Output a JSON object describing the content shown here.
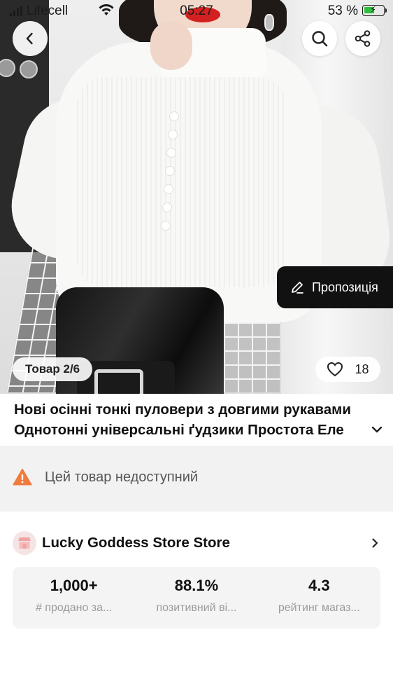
{
  "status_bar": {
    "carrier": "Lifecell",
    "time": "05:27",
    "battery_pct": "53 %",
    "battery_level": 0.53,
    "battery_color": "#2fbf3b"
  },
  "nav": {
    "back_icon": "chevron-left-icon",
    "search_icon": "search-icon",
    "share_icon": "share-icon"
  },
  "gallery": {
    "counter": "Товар 2/6",
    "likes": "18",
    "proposal_label": "Пропозиція"
  },
  "product": {
    "title_line1": "Нові осінні тонкі пуловери з довгими рукавами",
    "title_line2": "Однотонні універсальні ґудзики Простота Еле"
  },
  "availability": {
    "message": "Цей товар недоступний",
    "icon_color": "#ef7b3f"
  },
  "store": {
    "name": "Lucky Goddess Store Store",
    "stats": [
      {
        "value": "1,000+",
        "label": "# продано за..."
      },
      {
        "value": "88.1%",
        "label": "позитивний ві..."
      },
      {
        "value": "4.3",
        "label": "рейтинг магаз..."
      }
    ]
  }
}
